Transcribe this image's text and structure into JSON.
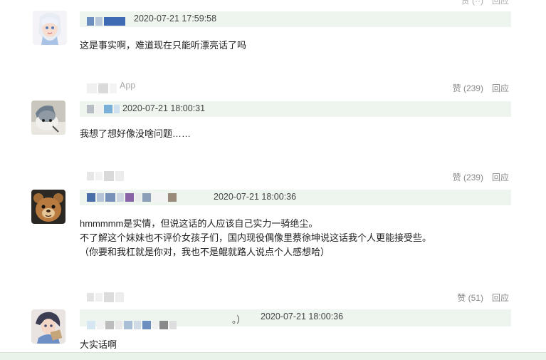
{
  "comments": [
    {
      "id": "c1",
      "timestamp": "2020-07-21 17:59:58",
      "content_lines": [
        "这是事实啊，难道现在只能听漂亮话了吗"
      ],
      "actions": {
        "like": "",
        "reply": ""
      },
      "avatar_icon": "elsa-avatar"
    },
    {
      "id": "c2",
      "username_suffix": "App",
      "timestamp": "2020-07-21 18:00:31",
      "content_lines": [
        "我想了想好像没啥问题……"
      ],
      "actions": {
        "like": "赞 (239)",
        "reply": "回应"
      },
      "avatar_icon": "cat-avatar"
    },
    {
      "id": "c3",
      "timestamp": "2020-07-21 18:00:36",
      "content_lines": [
        "hmmmmm是实情，但说这话的人应该自己实力一骑绝尘。",
        "不了解这个妹妹也不评价女孩子们，国内现役偶像里蔡徐坤说这话我个人更能接受些。",
        "（你要和我杠就是你对，我也不是鲲就路人说点个人感想哈）"
      ],
      "actions": {
        "like": "赞 (239)",
        "reply": "回应"
      },
      "avatar_icon": "teddy-bear-avatar"
    },
    {
      "id": "c4",
      "quote_suffix": "。）",
      "timestamp": "2020-07-21 18:00:36",
      "content_lines": [
        "大实话啊"
      ],
      "actions": {
        "like": "赞 (51)",
        "reply": "回应"
      },
      "avatar_icon": "anime-avatar"
    }
  ],
  "colors": {
    "timebar_bg": "#eef5ee",
    "action_text": "#888888",
    "body_text": "#222222"
  }
}
